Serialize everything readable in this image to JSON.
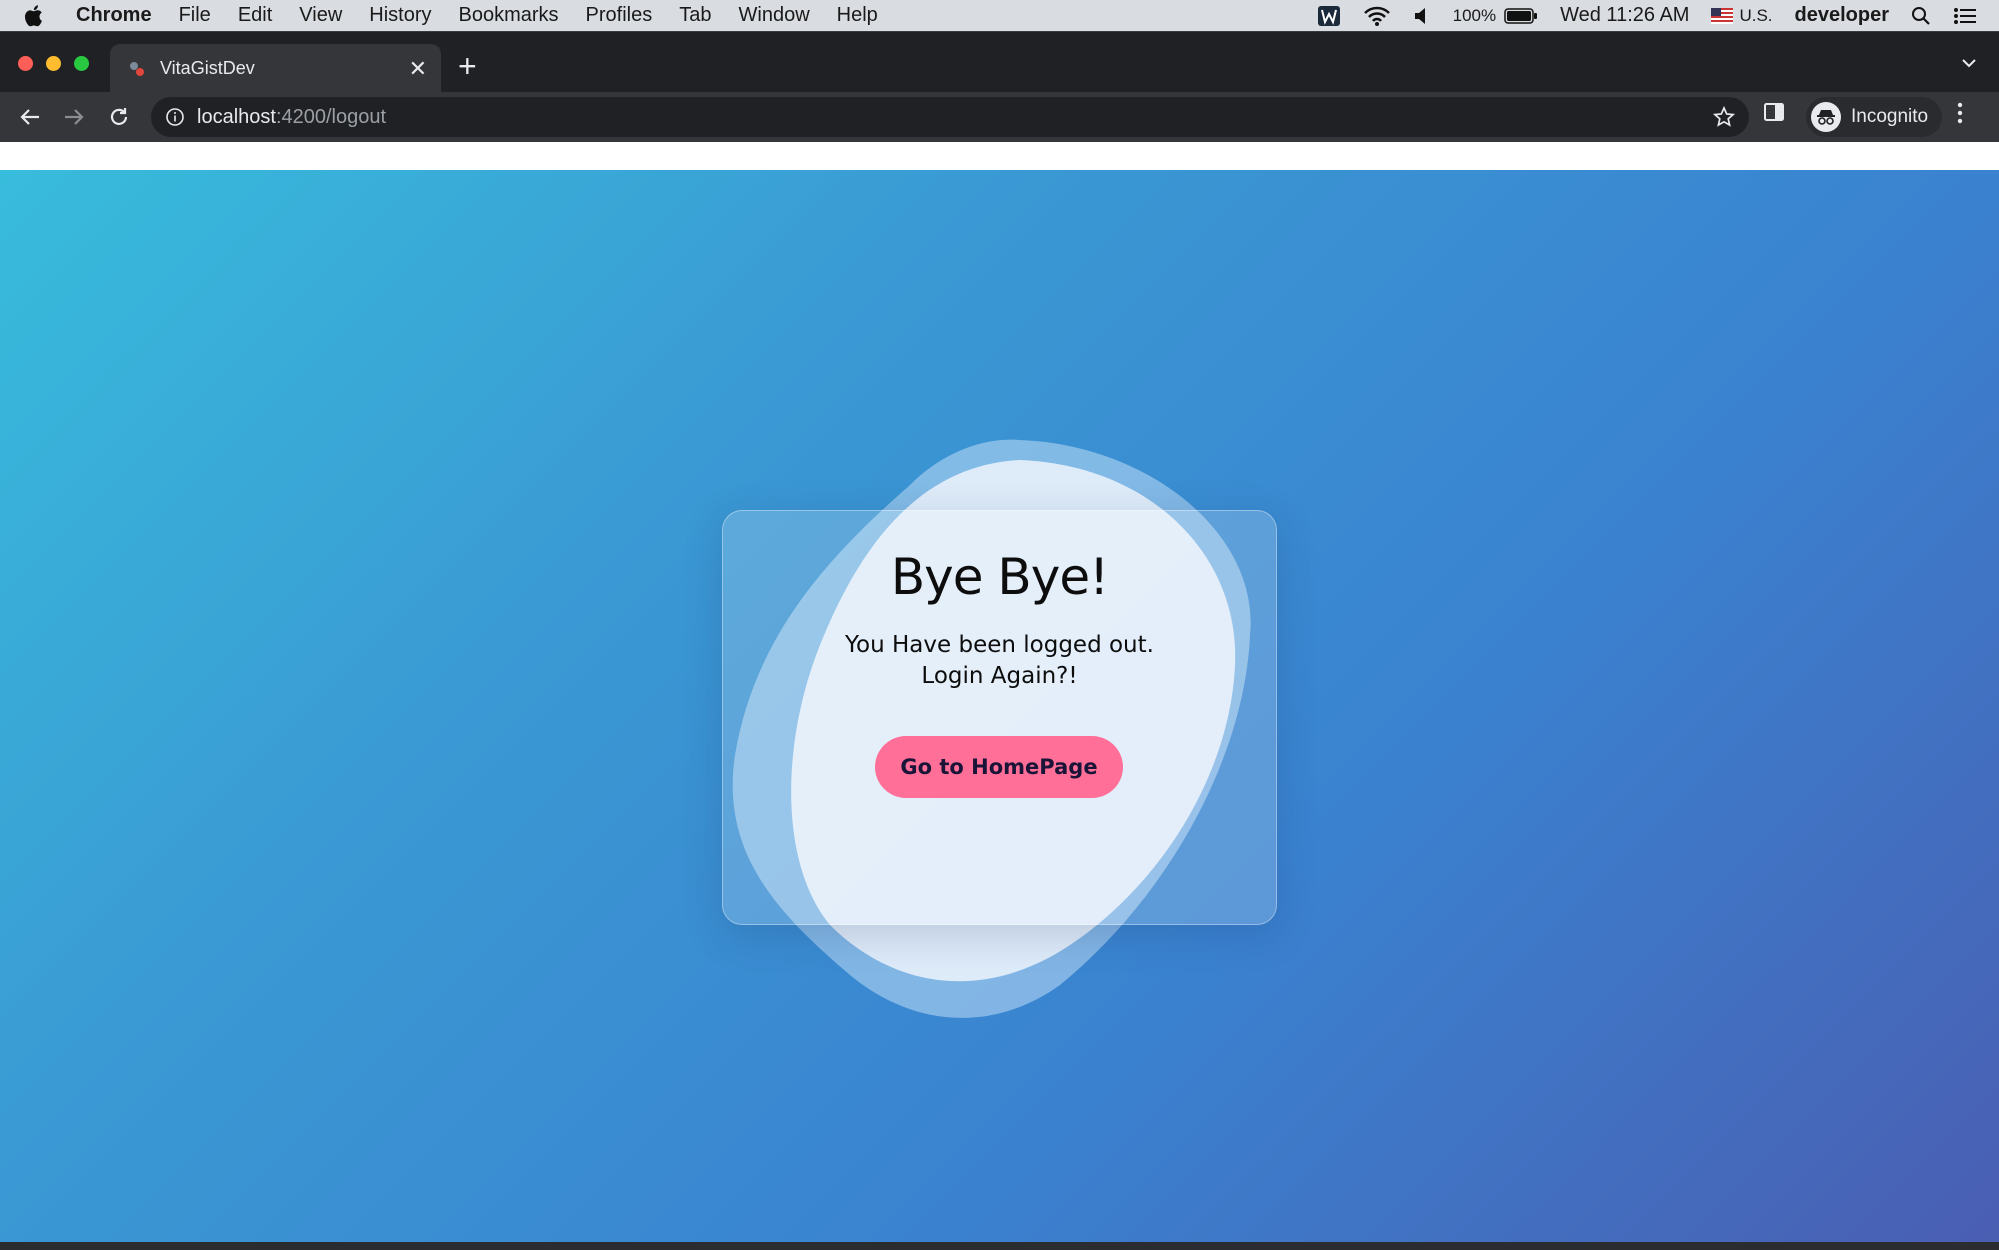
{
  "menubar": {
    "app_name": "Chrome",
    "items": [
      "File",
      "Edit",
      "View",
      "History",
      "Bookmarks",
      "Profiles",
      "Tab",
      "Window",
      "Help"
    ],
    "battery": "100%",
    "datetime": "Wed 11:26 AM",
    "input_source": "U.S.",
    "user": "developer"
  },
  "browser": {
    "tab_title": "VitaGistDev",
    "url_host": "localhost",
    "url_path": ":4200/logout",
    "profile_label": "Incognito"
  },
  "page": {
    "heading": "Bye Bye!",
    "message_line1": "You Have been logged out.",
    "message_line2": "Login Again?!",
    "button_label": "Go to HomePage"
  },
  "colors": {
    "button": "#ff6f97",
    "gradient_start": "#38bcdc",
    "gradient_end": "#4a5eb2"
  }
}
